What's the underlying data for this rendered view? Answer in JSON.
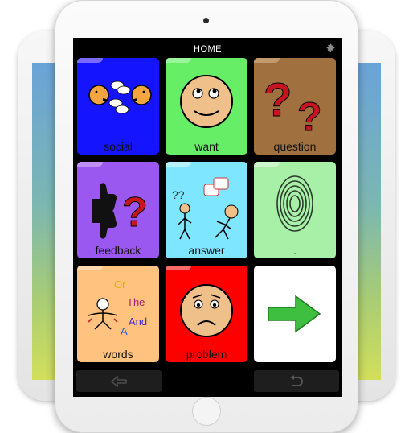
{
  "header": {
    "title": "HOME"
  },
  "icons": {
    "settings": "gear-icon",
    "back": "back-arrow-icon",
    "undo": "undo-icon"
  },
  "tiles": [
    {
      "label": "social",
      "bg": "#1414ff",
      "tab": "#7a6aff",
      "icon": "talking-faces-icon"
    },
    {
      "label": "want",
      "bg": "#66ee66",
      "tab": "#9bf59b",
      "icon": "thinking-face-icon"
    },
    {
      "label": "question",
      "bg": "#a0703e",
      "tab": "#c39a6f",
      "icon": "question-marks-icon"
    },
    {
      "label": "feedback",
      "bg": "#9a58f0",
      "tab": "#c08ff7",
      "icon": "thumbs-question-icon"
    },
    {
      "label": "answer",
      "bg": "#7fe6ff",
      "tab": "#b6f2ff",
      "icon": "people-questions-icon"
    },
    {
      "label": ".",
      "bg": "#a8f0a8",
      "tab": "#cbf7cb",
      "icon": "fingerprint-icon"
    },
    {
      "label": "words",
      "bg": "#ffc27f",
      "tab": "#ffd9ad",
      "icon": "words-figure-icon"
    },
    {
      "label": "problem",
      "bg": "#ff0000",
      "tab": "#ff6a6a",
      "icon": "worried-face-icon"
    },
    {
      "label": "",
      "bg": "#ffffff",
      "tab": "#ffffff",
      "icon": "arrow-right-icon"
    }
  ],
  "word_cloud": [
    "Or",
    "The",
    "And",
    "A"
  ],
  "colors": {
    "screen_bg": "#000000",
    "arrow_green": "#3fbf3f"
  }
}
